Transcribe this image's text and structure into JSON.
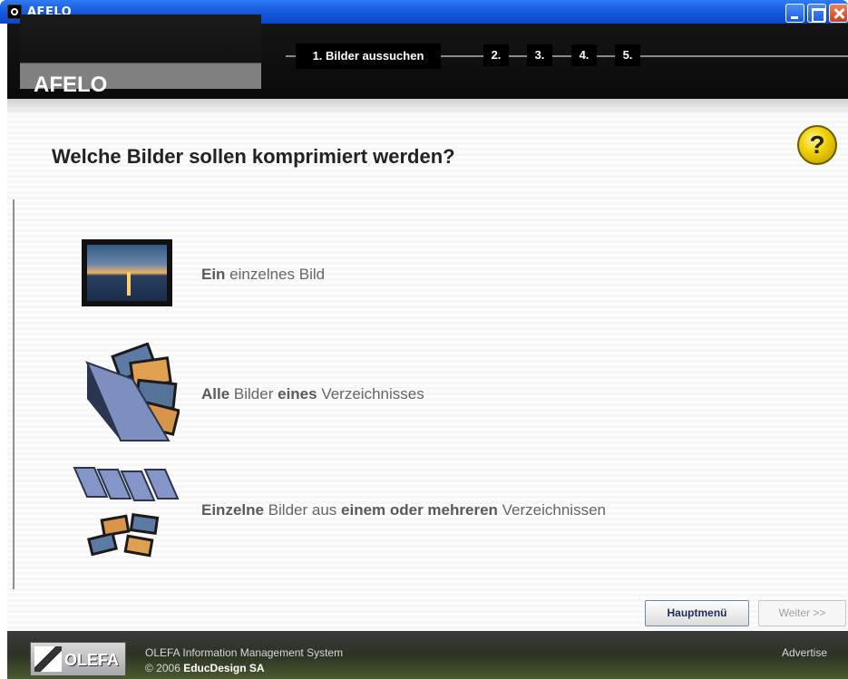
{
  "window": {
    "title": "AFELO"
  },
  "header": {
    "brand": "AFELO",
    "steps": [
      {
        "label": "1. Bilder aussuchen",
        "active": true
      },
      {
        "label": "2.",
        "active": false
      },
      {
        "label": "3.",
        "active": false
      },
      {
        "label": "4.",
        "active": false
      },
      {
        "label": "5.",
        "active": false
      }
    ]
  },
  "main": {
    "help_label": "?",
    "question": "Welche Bilder sollen komprimiert werden?",
    "options": [
      {
        "icon": "single-picture-icon",
        "bold1": "Ein",
        "rest1": " einzelnes Bild"
      },
      {
        "icon": "folder-pictures-icon",
        "bold1": "Alle",
        "rest1": " Bilder ",
        "bold2": "eines",
        "rest2": " Verzeichnisses"
      },
      {
        "icon": "multiple-folders-icon",
        "bold1": "Einzelne",
        "rest1": " Bilder aus ",
        "bold2": "einem oder mehreren",
        "rest2": " Verzeichnissen"
      }
    ]
  },
  "buttons": {
    "main_menu": "Hauptmenü",
    "next": "Weiter >>"
  },
  "footer": {
    "logo_text": "OLEFA",
    "line1": "OLEFA Information Management System",
    "line2_prefix": "© 2006 ",
    "line2_company": "EducDesign SA",
    "advertise": "Advertise"
  }
}
